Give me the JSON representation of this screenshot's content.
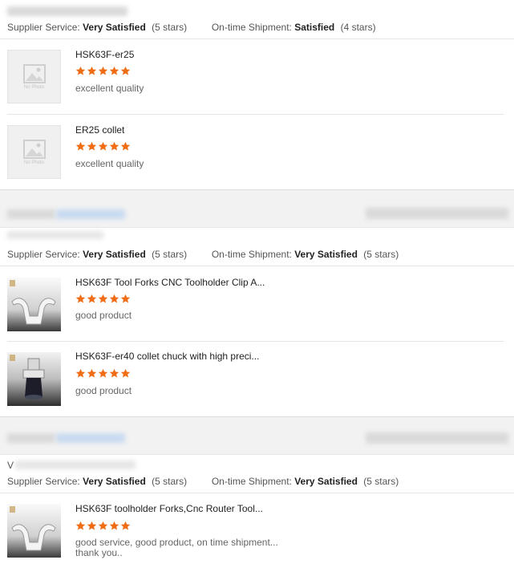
{
  "labels": {
    "supplier_service": "Supplier Service:",
    "on_time_shipment": "On-time Shipment:"
  },
  "colors": {
    "star": "#f06c15",
    "accent_blue": "#2a6fd4"
  },
  "reviews": [
    {
      "supplier_service": {
        "rating": "Very Satisfied",
        "stars": "(5 stars)"
      },
      "on_time_shipment": {
        "rating": "Satisfied",
        "stars": "(4 stars)"
      },
      "items": [
        {
          "product": "HSK63F-er25",
          "stars": 5,
          "comment": "excellent quality",
          "image": "no-photo",
          "no_photo_text": "No Photo"
        },
        {
          "product": "ER25 collet",
          "stars": 5,
          "comment": "excellent quality",
          "image": "no-photo",
          "no_photo_text": "No Photo"
        }
      ]
    },
    {
      "supplier_service": {
        "rating": "Very Satisfied",
        "stars": "(5 stars)"
      },
      "on_time_shipment": {
        "rating": "Very Satisfied",
        "stars": "(5 stars)"
      },
      "items": [
        {
          "product": "HSK63F Tool Forks CNC Toolholder Clip A...",
          "stars": 5,
          "comment": "good product",
          "image": "tool-fork-photo"
        },
        {
          "product": "HSK63F-er40 collet chuck with high preci...",
          "stars": 5,
          "comment": "good product",
          "image": "collet-chuck-photo"
        }
      ]
    },
    {
      "reviewer_initial": "V",
      "supplier_service": {
        "rating": "Very Satisfied",
        "stars": "(5 stars)"
      },
      "on_time_shipment": {
        "rating": "Very Satisfied",
        "stars": "(5 stars)"
      },
      "items": [
        {
          "product": "HSK63F toolholder Forks,Cnc Router Tool...",
          "stars": 5,
          "comment_line1": "good service, good product, on time shipment...",
          "comment_line2": "thank you..",
          "image": "tool-fork-photo"
        }
      ]
    }
  ]
}
